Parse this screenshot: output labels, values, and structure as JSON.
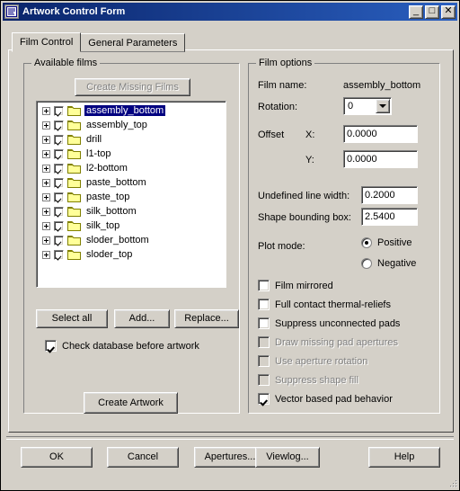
{
  "window": {
    "title": "Artwork Control Form",
    "icon": "form-icon",
    "buttons": {
      "minimize": "_",
      "maximize": "□",
      "close": "✕"
    }
  },
  "tabs": [
    {
      "label": "Film Control",
      "active": true
    },
    {
      "label": "General Parameters",
      "active": false
    }
  ],
  "available_films": {
    "title": "Available films",
    "create_missing_films_label": "Create Missing Films",
    "items": [
      {
        "label": "assembly_bottom",
        "checked": true,
        "selected": true
      },
      {
        "label": "assembly_top",
        "checked": true,
        "selected": false
      },
      {
        "label": "drill",
        "checked": true,
        "selected": false
      },
      {
        "label": "l1-top",
        "checked": true,
        "selected": false
      },
      {
        "label": "l2-bottom",
        "checked": true,
        "selected": false
      },
      {
        "label": "paste_bottom",
        "checked": true,
        "selected": false
      },
      {
        "label": "paste_top",
        "checked": true,
        "selected": false
      },
      {
        "label": "silk_bottom",
        "checked": true,
        "selected": false
      },
      {
        "label": "silk_top",
        "checked": true,
        "selected": false
      },
      {
        "label": "sloder_bottom",
        "checked": true,
        "selected": false
      },
      {
        "label": "sloder_top",
        "checked": true,
        "selected": false
      }
    ],
    "select_all_label": "Select all",
    "add_label": "Add...",
    "replace_label": "Replace...",
    "check_database_label": "Check database before artwork",
    "check_database_checked": true,
    "create_artwork_label": "Create Artwork"
  },
  "film_options": {
    "title": "Film options",
    "film_name_label": "Film name:",
    "film_name_value": "assembly_bottom",
    "rotation_label": "Rotation:",
    "rotation_value": "0",
    "offset_label": "Offset",
    "offset_x_label": "X:",
    "offset_x_value": "0.0000",
    "offset_y_label": "Y:",
    "offset_y_value": "0.0000",
    "undefined_line_width_label": "Undefined line width:",
    "undefined_line_width_value": "0.2000",
    "shape_bounding_box_label": "Shape bounding box:",
    "shape_bounding_box_value": "2.5400",
    "plot_mode_label": "Plot mode:",
    "plot_mode_positive": "Positive",
    "plot_mode_negative": "Negative",
    "plot_mode_selected": "Positive",
    "checkboxes": [
      {
        "label": "Film mirrored",
        "checked": false,
        "disabled": false
      },
      {
        "label": "Full contact thermal-reliefs",
        "checked": false,
        "disabled": false
      },
      {
        "label": "Suppress unconnected pads",
        "checked": false,
        "disabled": false
      },
      {
        "label": "Draw missing pad apertures",
        "checked": false,
        "disabled": true
      },
      {
        "label": "Use aperture rotation",
        "checked": false,
        "disabled": true
      },
      {
        "label": "Suppress shape fill",
        "checked": false,
        "disabled": true
      },
      {
        "label": "Vector based pad behavior",
        "checked": true,
        "disabled": false
      }
    ]
  },
  "footer": {
    "ok_label": "OK",
    "cancel_label": "Cancel",
    "apertures_label": "Apertures...",
    "viewlog_label": "Viewlog...",
    "help_label": "Help"
  },
  "colors": {
    "face": "#d4d0c8",
    "title_start": "#0a246a",
    "title_end": "#2a5fbf",
    "selection": "#000080",
    "folder": "#ffff99",
    "folder_edge": "#808000",
    "disabled_text": "#808080"
  }
}
